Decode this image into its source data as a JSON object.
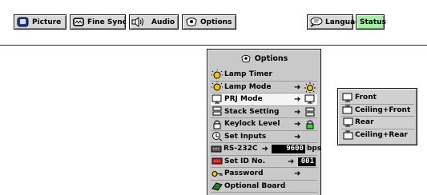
{
  "topbar": {
    "tabs": [
      {
        "label": "Picture",
        "icon": "picture-icon"
      },
      {
        "label": "Fine Sync",
        "icon": "fine-sync-icon"
      },
      {
        "label": "Audio",
        "icon": "speaker-icon"
      },
      {
        "label": "Options",
        "icon": "options-icon"
      }
    ],
    "right_tabs": [
      {
        "label": "Language",
        "icon": "speech-bubble-icon"
      },
      {
        "label": "Status",
        "icon": ""
      }
    ]
  },
  "menu": {
    "title": "Options",
    "items": [
      {
        "label": "Lamp Timer",
        "icon": "lamp-icon",
        "arrow": "",
        "sub": ""
      },
      {
        "label": "Lamp Mode",
        "icon": "lamp-icon",
        "arrow": "➜",
        "sub": "lamp-mode-icon"
      },
      {
        "label": "PRJ Mode",
        "icon": "projector-icon",
        "arrow": "➜",
        "sub": "projector-icon",
        "selected": true
      },
      {
        "label": "Stack Setting",
        "icon": "stack-icon",
        "arrow": "➜",
        "sub": "stack-icon"
      },
      {
        "label": "Keylock Level",
        "icon": "lock-icon",
        "arrow": "➜",
        "sub": "lock-icon"
      },
      {
        "label": "Set Inputs",
        "icon": "set-inputs-icon",
        "arrow": "➜",
        "sub": ""
      },
      {
        "label": "RS-232C",
        "icon": "rs232c-icon",
        "arrow": "➜",
        "value": "9600",
        "unit": "bps"
      },
      {
        "label": "Set ID No.",
        "icon": "id-icon",
        "arrow": "➜",
        "value": "001"
      },
      {
        "label": "Password",
        "icon": "key-icon",
        "arrow": "➜",
        "sub": ""
      },
      {
        "label": "Optional Board",
        "icon": "board-icon",
        "arrow": "",
        "sub": ""
      }
    ]
  },
  "submenu": {
    "items": [
      {
        "label": "Front",
        "icon": "front-icon"
      },
      {
        "label": "Ceiling+Front",
        "icon": "ceiling-front-icon"
      },
      {
        "label": "Rear",
        "icon": "rear-icon"
      },
      {
        "label": "Ceiling+Rear",
        "icon": "ceiling-rear-icon"
      }
    ]
  },
  "colors": {
    "status_tab": "#a6f0a6",
    "menu_bg": "#c9c9c9",
    "selected_row": "#f4f4f4"
  }
}
